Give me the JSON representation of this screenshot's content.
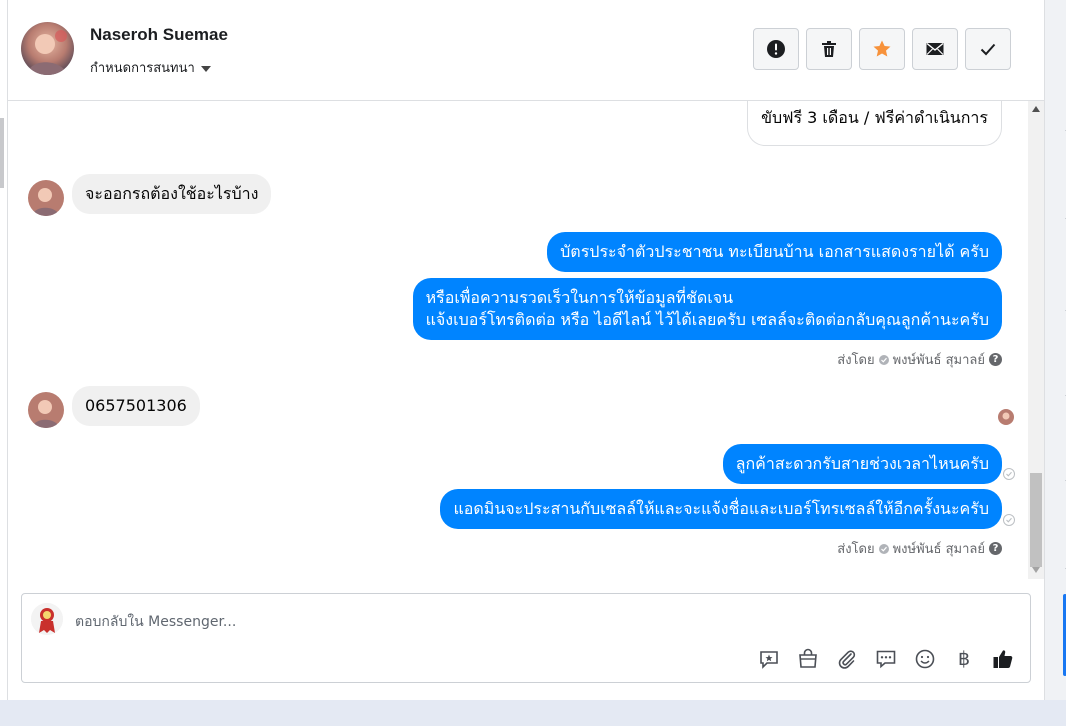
{
  "header": {
    "contact_name": "Naseroh Suemae",
    "assign_label": "กำหนดการสนทนา",
    "action_icons": [
      "alert-icon",
      "trash-icon",
      "star-icon",
      "envelope-icon",
      "checkmark-icon"
    ],
    "star_color": "#f7923b"
  },
  "messages": {
    "m0": "ขับฟรี 3 เดือน / ฟรีค่าดำเนินการ",
    "m1": "จะออกรถต้องใช้อะไรบ้าง",
    "m2": "บัตรประจำตัวประชาชน ทะเบียนบ้าน เอกสารแสดงรายได้ ครับ",
    "m3_line1": "หรือเพื่อความรวดเร็วในการให้ข้อมูลที่ชัดเจน",
    "m3_line2": "แจ้งเบอร์โทรติดต่อ หรือ ไอดีไลน์ ไว้ได้เลยครับ เซลล์จะติดต่อกลับคุณลูกค้านะครับ",
    "m4": "0657501306",
    "m5": "ลูกค้าสะดวกรับสายช่วงเวลาไหนครับ",
    "m6": "แอดมินจะประสานกับเซลล์ให้และจะแจ้งชื่อและเบอร์โทรเซลล์ให้อีกครั้งนะครับ"
  },
  "sent_by": {
    "prefix": "ส่งโดย",
    "agent_name": "พงษ์พันธ์ สุมาลย์"
  },
  "composer": {
    "placeholder": "ตอบกลับใน Messenger...",
    "tool_icons": [
      "saved-reply-icon",
      "shopping-bag-icon",
      "paperclip-icon",
      "chat-bubble-icon",
      "emoji-icon",
      "baht-icon",
      "thumbs-up-icon"
    ],
    "currency_symbol": "฿"
  },
  "colors": {
    "outgoing_bubble": "#0084ff",
    "incoming_bubble": "#f0f0f0",
    "accent_blue": "#1877f2"
  }
}
